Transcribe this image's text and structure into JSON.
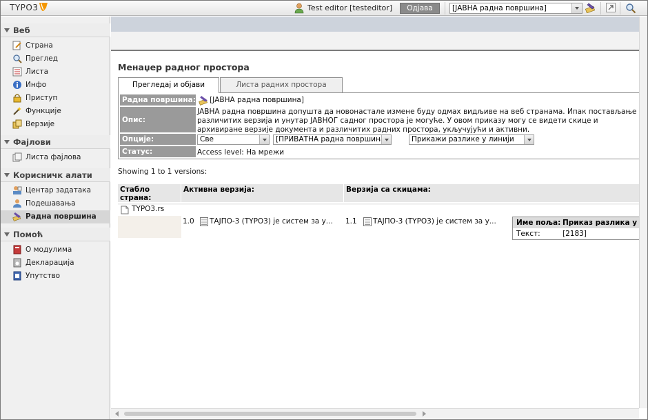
{
  "topbar": {
    "logo_text": "TYPO3",
    "user_label": "Test editor [testeditor]",
    "logout_label": "Одјава",
    "workspace_selected": "[ЈАВНА радна површина]"
  },
  "sidebar": {
    "sections": [
      {
        "title": "Веб",
        "items": [
          "Страна",
          "Преглед",
          "Листа",
          "Инфо",
          "Приступ",
          "Функције",
          "Верзије"
        ]
      },
      {
        "title": "Фајлови",
        "items": [
          "Листа фајлова"
        ]
      },
      {
        "title": "Корисничк алати",
        "items": [
          "Центар задатака",
          "Подешавања",
          "Радна површина"
        ]
      },
      {
        "title": "Помоћ",
        "items": [
          "О модулима",
          "Декларација",
          "Упутство"
        ]
      }
    ],
    "active_item": "Радна површина"
  },
  "content": {
    "page_title": "Менаџер радног простора",
    "tabs": [
      "Прегледај и објави",
      "Листа радних простора"
    ],
    "info": {
      "workspace_label": "Радна површина:",
      "workspace_value": "[ЈАВНА радна површина]",
      "description_label": "Опис:",
      "description_value": "ЈАВНА радна површина допушта да новонастале измене буду одмах видљиве на веб странама. Ипак постављање различитих верзија и унутар ЈАВНОГ садног простора је могуће. У овом приказу могу се видети скице и архивиране верзије документа и различитих радних простора, укључујући и активни.",
      "options_label": "Опције:",
      "option_1": "Све",
      "option_2": "[ПРИВАТНА радна површина]",
      "option_3": "Прикажи разлике у линији",
      "status_label": "Статус:",
      "status_value": "Access level: На мрежи"
    },
    "showing": "Showing 1 to 1 versions:",
    "table": {
      "headers": [
        "Стабло страна:",
        "Активна верзија:",
        "Верзија са скицама:"
      ],
      "page": "TYPO3.rs",
      "active_version_num": "1.0",
      "active_version_title": "ТАЈПО-3 (TYPO3) је систем за у...",
      "draft_version_num": "1.1",
      "draft_version_title": "ТАЈПО-3 (TYPO3) је систем за у..."
    },
    "diff": {
      "field_header": "Име поља:",
      "diff_header": "Приказ разлика у раз",
      "field_name": "Текст:",
      "field_value": "[2183]"
    }
  },
  "colors": {
    "header_band": "#cdd3dc",
    "label_bg": "#9a9a9a",
    "logout_bg": "#8a8a8a",
    "logo_orange": "#f49700"
  }
}
